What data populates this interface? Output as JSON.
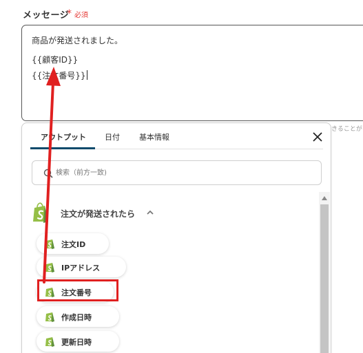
{
  "field": {
    "label": "メッセージ",
    "required_star": "*",
    "required_text": "必須"
  },
  "message_lines": [
    "商品が発送されました。",
    "{{顧客ID}}",
    "{{注文番号}}"
  ],
  "side_text": "きることが",
  "popup": {
    "tabs": [
      "アウトプット",
      "日付",
      "基本情報"
    ],
    "active_tab": 0,
    "search": {
      "placeholder": "検索（前方一致)"
    },
    "group": {
      "label": "注文が発送されたら",
      "icon": "shopify-icon",
      "expanded": true
    },
    "items": [
      "注文ID",
      "IPアドレス",
      "注文番号",
      "作成日時",
      "更新日時"
    ],
    "highlighted_item": "注文番号"
  },
  "colors": {
    "accent": "#0b4a6b",
    "required": "#e53935",
    "annotation": "#e02020",
    "shopify_green": "#95bf47",
    "shopify_dark": "#5e8e3e"
  }
}
